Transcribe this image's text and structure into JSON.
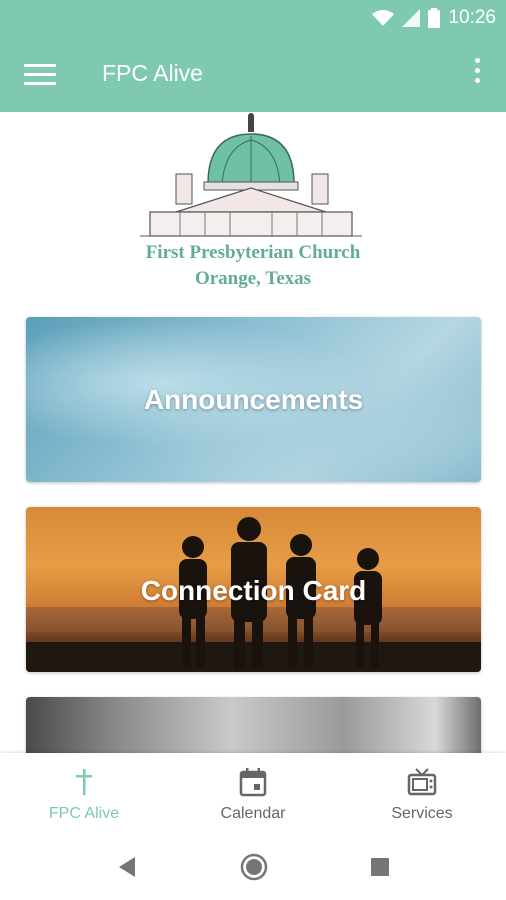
{
  "status_bar": {
    "time": "10:26"
  },
  "toolbar": {
    "title": "FPC Alive"
  },
  "logo": {
    "line1": "First Presbyterian Church",
    "line2": "Orange, Texas"
  },
  "cards": [
    {
      "label": "Announcements"
    },
    {
      "label": "Connection Card"
    },
    {
      "label": ""
    }
  ],
  "bottom_nav": {
    "items": [
      {
        "label": "FPC Alive",
        "icon": "cross-icon",
        "active": true
      },
      {
        "label": "Calendar",
        "icon": "calendar-icon",
        "active": false
      },
      {
        "label": "Services",
        "icon": "tv-icon",
        "active": false
      }
    ]
  },
  "colors": {
    "accent": "#7fcaae",
    "inactive_text": "#666666"
  }
}
